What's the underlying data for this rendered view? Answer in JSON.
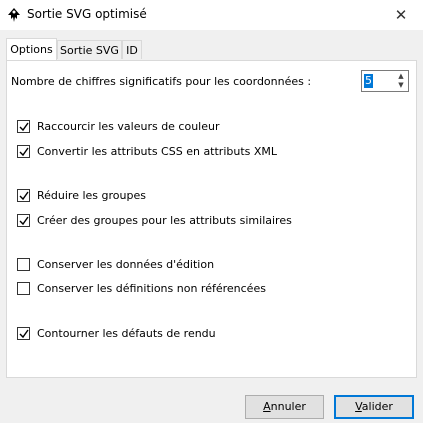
{
  "window": {
    "title": "Sortie SVG optimisé",
    "close_glyph": "✕"
  },
  "tabs": [
    {
      "label": "Options",
      "active": true
    },
    {
      "label": "Sortie SVG",
      "active": false
    },
    {
      "label": "ID",
      "active": false
    }
  ],
  "options": {
    "precision_label": "Nombre de chiffres significatifs pour les coordonnées :",
    "precision_value": "5",
    "checkboxes": [
      {
        "label": "Raccourcir les valeurs de couleur",
        "checked": true
      },
      {
        "label": "Convertir les attributs CSS en attributs XML",
        "checked": true
      },
      {
        "label": "Réduire les groupes",
        "checked": true
      },
      {
        "label": "Créer des groupes pour les attributs similaires",
        "checked": true
      },
      {
        "label": "Conserver les données d'édition",
        "checked": false
      },
      {
        "label": "Conserver les définitions non référencées",
        "checked": false
      },
      {
        "label": "Contourner les défauts de rendu",
        "checked": true
      }
    ]
  },
  "buttons": {
    "cancel": {
      "first": "A",
      "rest": "nnuler"
    },
    "ok": {
      "first": "V",
      "rest": "alider"
    }
  },
  "icons": {
    "app": "inkscape-icon",
    "close": "close-icon",
    "check": "check-icon"
  }
}
